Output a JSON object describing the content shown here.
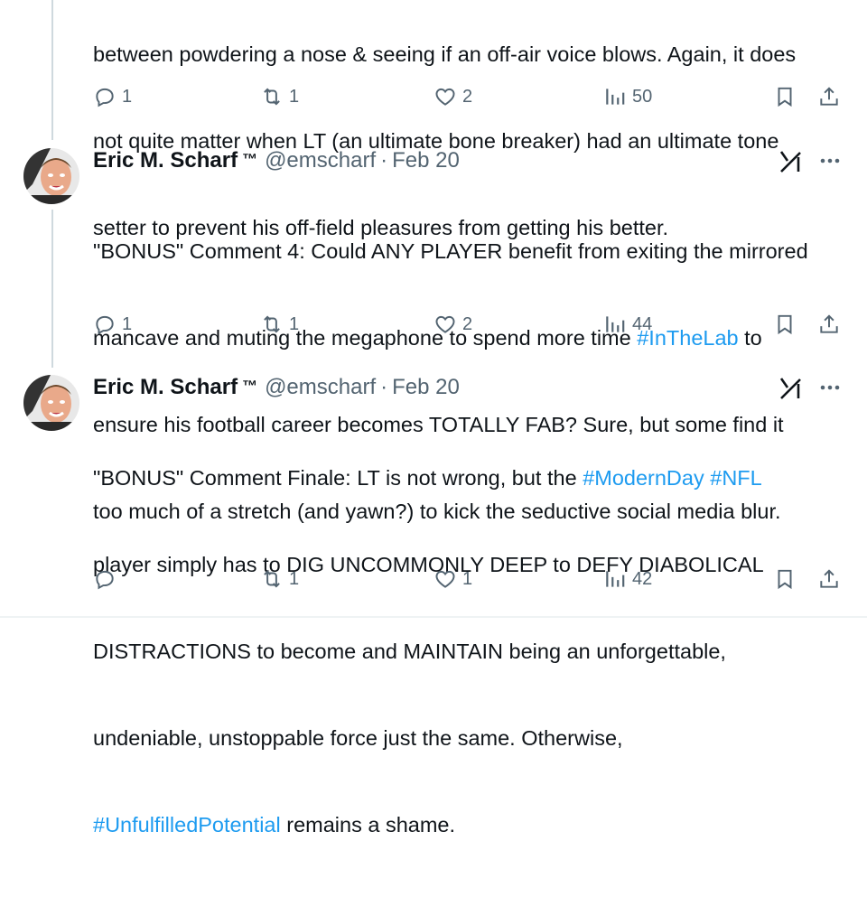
{
  "tweets": [
    {
      "text_partial": "between powdering a nose & seeing if an off-air voice blows. Again, it does not quite matter when LT (an ultimate bone breaker) had an ultimate tone setter to prevent his off-field pleasures from getting his better.",
      "line1": "between powdering a nose & seeing if an off-air voice blows. Again, it does",
      "line2": "not quite matter when LT (an ultimate bone breaker) had an ultimate tone",
      "line3": "setter to prevent his off-field pleasures from getting his better.",
      "replies": "1",
      "reposts": "1",
      "likes": "2",
      "views": "50"
    },
    {
      "name": "Eric M. Scharf",
      "tm": "™",
      "handle": "@emscharf",
      "sep": "·",
      "date": "Feb 20",
      "line1": "\"BONUS\" Comment 4: Could ANY PLAYER benefit from exiting the mirrored",
      "line2a": "mancave and muting the megaphone to spend more time ",
      "line2tag": "#InTheLab",
      "line2b": " to",
      "line3": "ensure his football career becomes TOTALLY FAB? Sure, but some find it",
      "line4": "too much of a stretch (and yawn?) to kick the seductive social media blur.",
      "replies": "1",
      "reposts": "1",
      "likes": "2",
      "views": "44"
    },
    {
      "name": "Eric M. Scharf",
      "tm": "™",
      "handle": "@emscharf",
      "sep": "·",
      "date": "Feb 20",
      "line1a": "\"BONUS\" Comment Finale: LT is not wrong, but the ",
      "line1tag1": "#ModernDay",
      "line1sp": " ",
      "line1tag2": "#NFL",
      "line2": "player simply has to DIG UNCOMMONLY DEEP to DEFY DIABOLICAL",
      "line3": "DISTRACTIONS to become and MAINTAIN being an unforgettable,",
      "line4": "undeniable, unstoppable force just the same. Otherwise,",
      "line5tag": "#UnfulfilledPotential",
      "line5b": " remains a shame.",
      "replies": "",
      "reposts": "1",
      "likes": "1",
      "views": "42"
    }
  ],
  "icons": {
    "reply": "reply-icon",
    "repost": "repost-icon",
    "like": "heart-icon",
    "views": "views-icon",
    "bookmark": "bookmark-icon",
    "share": "share-icon",
    "grok": "grok-icon",
    "more": "more-icon"
  },
  "colors": {
    "hashtag": "#1d9bf0",
    "muted": "#536471",
    "text": "#0f1419",
    "thread": "#cfd9de"
  }
}
